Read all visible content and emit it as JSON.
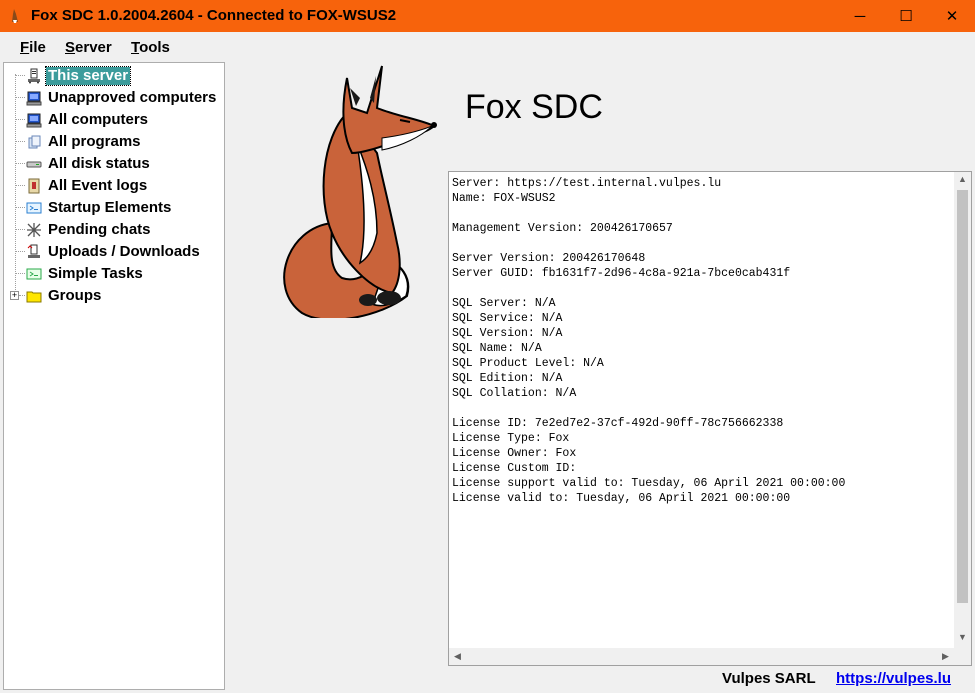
{
  "window": {
    "title": "Fox SDC 1.0.2004.2604 - Connected to FOX-WSUS2",
    "titlebar_color": "#f7630c",
    "controls": {
      "minimize": "─",
      "maximize": "☐",
      "close": "✕"
    }
  },
  "menu": {
    "file": {
      "accel": "F",
      "rest": "ile"
    },
    "server": {
      "accel": "S",
      "rest": "erver"
    },
    "tools": {
      "accel": "T",
      "rest": "ools"
    }
  },
  "tree": {
    "items": [
      {
        "label": "This server",
        "icon": "server-icon",
        "selected": true
      },
      {
        "label": "Unapproved computers",
        "icon": "computer-warning-icon"
      },
      {
        "label": "All computers",
        "icon": "computer-icon"
      },
      {
        "label": "All programs",
        "icon": "programs-icon"
      },
      {
        "label": "All disk status",
        "icon": "disk-icon"
      },
      {
        "label": "All Event logs",
        "icon": "event-log-icon"
      },
      {
        "label": "Startup Elements",
        "icon": "startup-icon"
      },
      {
        "label": "Pending chats",
        "icon": "chat-icon"
      },
      {
        "label": "Uploads / Downloads",
        "icon": "transfer-icon"
      },
      {
        "label": "Simple Tasks",
        "icon": "tasks-icon"
      },
      {
        "label": "Groups",
        "icon": "folder-icon",
        "expander": "+"
      }
    ],
    "selection_color": "#3c9c9c"
  },
  "main": {
    "app_title": "Fox SDC",
    "info_lines": [
      "Server: https://test.internal.vulpes.lu",
      "Name: FOX-WSUS2",
      "",
      "Management Version: 200426170657",
      "",
      "Server Version: 200426170648",
      "Server GUID: fb1631f7-2d96-4c8a-921a-7bce0cab431f",
      "",
      "SQL Server: N/A",
      "SQL Service: N/A",
      "SQL Version: N/A",
      "SQL Name: N/A",
      "SQL Product Level: N/A",
      "SQL Edition: N/A",
      "SQL Collation: N/A",
      "",
      "License ID: 7e2ed7e2-37cf-492d-90ff-78c756662338",
      "License Type: Fox",
      "License Owner: Fox",
      "License Custom ID:",
      "License support valid to: Tuesday, 06 April 2021 00:00:00",
      "License valid to: Tuesday, 06 April 2021 00:00:00"
    ]
  },
  "footer": {
    "company": "Vulpes SARL",
    "link": "https://vulpes.lu",
    "link_color": "#0000ee"
  }
}
